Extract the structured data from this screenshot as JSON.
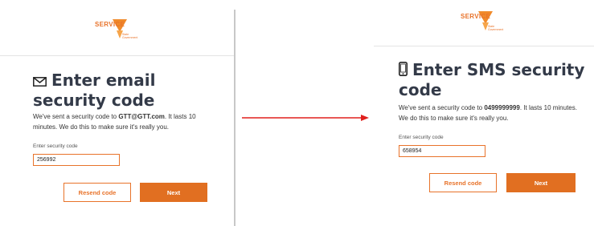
{
  "logo": {
    "wordmark": "SERVICE",
    "sub_line1": "State",
    "sub_line2": "Government"
  },
  "email_screen": {
    "title": "Enter email security code",
    "desc_before": "We've sent a security code to ",
    "desc_target": "GTT@GTT.com",
    "desc_after": ". It lasts 10 minutes. We do this to make sure it's really you.",
    "field_label": "Enter security code",
    "field_value": "256992",
    "resend_label": "Resend code",
    "next_label": "Next",
    "icon": "envelope-icon"
  },
  "sms_screen": {
    "title": "Enter SMS security code",
    "desc_before": "We've sent a security code to ",
    "desc_target": "0499999999",
    "desc_after": ". It lasts 10 minutes. We do this to make sure it's really you.",
    "field_label": "Enter security code",
    "field_value": "658954",
    "resend_label": "Resend code",
    "next_label": "Next",
    "icon": "mobile-phone-icon"
  },
  "colors": {
    "accent": "#e16f21",
    "heading": "#333a48",
    "arrow": "#e0201d"
  }
}
